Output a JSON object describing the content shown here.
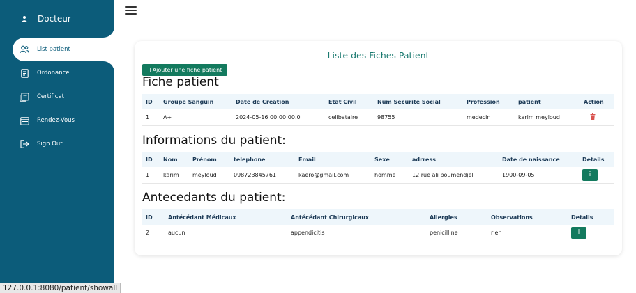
{
  "brand": {
    "label": "Docteur",
    "icon": "user-icon"
  },
  "sidebar": {
    "items": [
      {
        "label": "List patient",
        "icon": "users-icon",
        "active": true
      },
      {
        "label": "Ordonance",
        "icon": "document-icon"
      },
      {
        "label": "Certificat",
        "icon": "certificate-icon"
      },
      {
        "label": "Rendez-Vous",
        "icon": "calendar-icon"
      },
      {
        "label": "Sign Out",
        "icon": "sign-out-icon"
      }
    ]
  },
  "topbar": {
    "menu_icon": "hamburger-icon"
  },
  "card": {
    "title": "Liste des Fiches Patient",
    "add_button": "+Ajouter une fiche patient"
  },
  "fiche": {
    "heading": "Fiche patient",
    "headers": [
      "ID",
      "Groupe Sanguin",
      "Date de Creation",
      "Etat Civil",
      "Num Securite Social",
      "Profession",
      "patient",
      "Action"
    ],
    "rows": [
      [
        "1",
        "A+",
        "2024-05-16 00:00:00.0",
        "celibataire",
        "98755",
        "medecin",
        "karim meyloud"
      ]
    ]
  },
  "infos": {
    "heading": "Informations du patient:",
    "headers": [
      "ID",
      "Nom",
      "Prénom",
      "telephone",
      "Email",
      "Sexe",
      "adrress",
      "Date de naissance",
      "Details"
    ],
    "rows": [
      [
        "1",
        "karim",
        "meyloud",
        "098723845761",
        "kaero@gmail.com",
        "homme",
        "12 rue ali boumendjel",
        "1900-09-05"
      ]
    ],
    "details_button": "i"
  },
  "antecedants": {
    "heading": "Antecedants du patient:",
    "headers": [
      "ID",
      "Antécédant Médicaux",
      "Antécédant Chirurgicaux",
      "Allergies",
      "Observations",
      "Details"
    ],
    "rows": [
      [
        "2",
        "aucun",
        "appendicitis",
        "penicilline",
        "rien"
      ]
    ],
    "details_button": "i"
  },
  "status_url": "127.0.0.1:8080/patient/showall",
  "colors": {
    "sidebar": "#0c5c7a",
    "accent": "#137a5e",
    "title": "#1b7a70",
    "delete": "#d9534f"
  }
}
